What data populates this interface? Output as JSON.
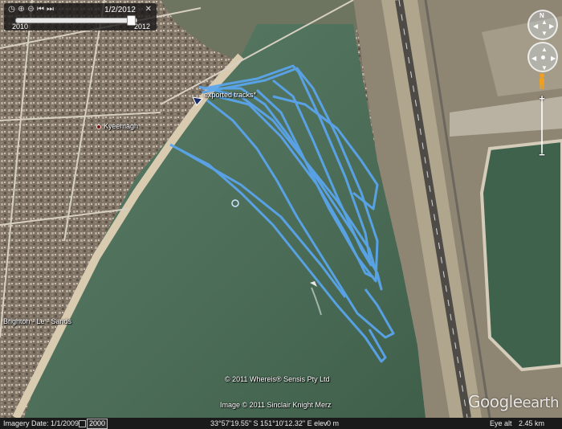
{
  "time_slider": {
    "current_date": "1/2/2012",
    "start_year": "2010",
    "end_year": "2012",
    "position": 0.95
  },
  "map": {
    "places": [
      {
        "name": "Kyeemagh"
      },
      {
        "name": "Brighton - Le - Sands"
      }
    ],
    "track_label": "exported tracks*",
    "copyright_1": "© 2011 Whereis® Sensis Pty Ltd",
    "copyright_2": "Image © 2011 Sinclair Knight Merz",
    "track_color": "#5aa6f0",
    "water_color": "#4d6f58",
    "land_color": "#8a7a68",
    "runway_color": "#a79a83"
  },
  "logo": {
    "word1": "Google",
    "word2": "earth"
  },
  "status": {
    "imagery_date": "Imagery Date: 1/1/2009",
    "year": "2000",
    "coords": "33°57'19.55\" S  151°10'12.32\" E  elev",
    "elev": "0 m",
    "eye_alt_label": "Eye alt",
    "eye_alt": "2.45 km"
  }
}
